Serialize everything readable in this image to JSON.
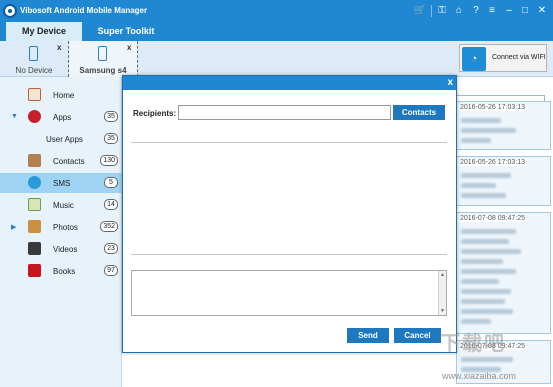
{
  "window": {
    "title": "Vibosoft Android Mobile Manager",
    "controls": [
      "cart-icon",
      "key-icon",
      "home-icon",
      "help-icon",
      "menu-icon",
      "minimize-icon",
      "close-icon"
    ]
  },
  "tabs": [
    {
      "label": "My Device",
      "active": true
    },
    {
      "label": "Super Toolkit",
      "active": false
    }
  ],
  "devices": [
    {
      "label": "No Device",
      "close": "x"
    },
    {
      "label": "Samsung s4",
      "close": "x"
    }
  ],
  "wifi_button": {
    "label": "Connect via WIFI"
  },
  "sidebar": {
    "items": [
      {
        "label": "Home",
        "count": ""
      },
      {
        "label": "Apps",
        "count": "35"
      },
      {
        "label": "User Apps",
        "count": "35"
      },
      {
        "label": "Contacts",
        "count": "130"
      },
      {
        "label": "SMS",
        "count": "5"
      },
      {
        "label": "Music",
        "count": "14"
      },
      {
        "label": "Photos",
        "count": "352"
      },
      {
        "label": "Videos",
        "count": "23"
      },
      {
        "label": "Books",
        "count": "97"
      }
    ]
  },
  "messages": [
    {
      "timestamp": "2016-05-26 17:03:13"
    },
    {
      "timestamp": "2016-05-26 17:03:13"
    },
    {
      "timestamp": "2016-07-08 09:47:25"
    },
    {
      "timestamp": "2016-07-08 09:47:25"
    }
  ],
  "dialog": {
    "close": "x",
    "recipients_label": "Recipients:",
    "recipients_value": "",
    "contacts_button": "Contacts",
    "message_value": "",
    "send_button": "Send",
    "cancel_button": "Cancel"
  },
  "watermark": {
    "text": "下载吧",
    "url": "www.xiazaiba.com"
  },
  "colors": {
    "accent": "#2088d2",
    "button": "#1e78c0",
    "sidebar_bg": "#e7f2fb",
    "selected": "#9fd3f3"
  }
}
